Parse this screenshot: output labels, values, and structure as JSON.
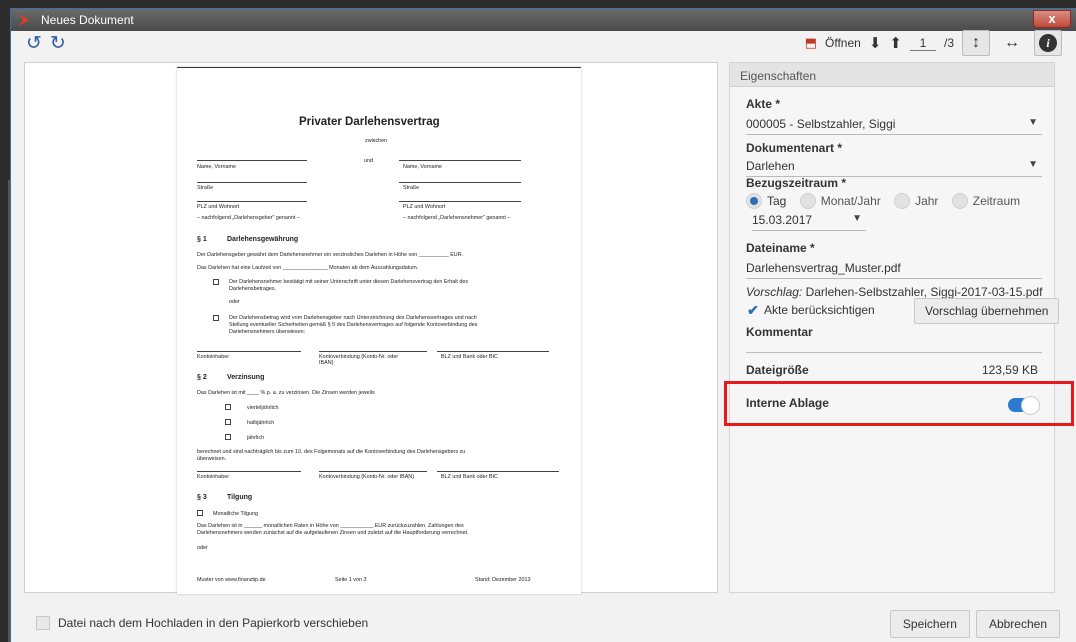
{
  "window": {
    "title": "Neues Dokument",
    "close_label": "x"
  },
  "toolbar": {
    "undo_icon": "undo-icon",
    "redo_icon": "redo-icon",
    "open_label": "Öffnen",
    "page_current": "1",
    "page_total": "/3"
  },
  "document": {
    "title": "Privater Darlehensvertrag",
    "zwischen": "zwischen",
    "und": "und",
    "name_left": "Name, Vorname",
    "name_right": "Name, Vorname",
    "strasse_left": "Straße",
    "strasse_right": "Straße",
    "plz_left": "PLZ und Wohnort",
    "plz_right": "PLZ und Wohnort",
    "nachfolgend_left": "– nachfolgend „Darlehensgeber\" genannt –",
    "nachfolgend_right": "– nachfolgend „Darlehensnehmer\" genannt –",
    "s1_num": "§ 1",
    "s1_title": "Darlehensgewährung",
    "s1_p1": "Der Darlehensgeber gewährt dem Darlehensnehmer ein verzinsliches Darlehen in Höhe von __________ EUR.",
    "s1_p2": "Das Darlehen hat eine Laufzeit von _______________ Monaten ab dem Auszahlungsdatum.",
    "s1_opt1a": "Der Darlehensnehmer bestätigt mit seiner Unterschrift unter diesen Darlehensvertrag den Erhalt des",
    "s1_opt1b": "Darlehensbetrages.",
    "s1_oder": "oder",
    "s1_opt2a": "Der Darlehensbetrag wird vom Darlehensgeber nach Unterzeichnung des Darlehensvertrages und nach",
    "s1_opt2b": "Stellung eventueller Sicherheiten gemäß § 5 des Darlehensvertrages auf folgende Kontoverbindung des",
    "s1_opt2c": "Darlehensnehmers überwiesen:",
    "kontoinhaber": "Kontoinhaber",
    "kontoverbindung_a": "Kontoverbindung (Konto-Nr. oder",
    "kontoverbindung_b": "IBAN)",
    "blz": "BLZ und Bank oder BIC",
    "s2_num": "§ 2",
    "s2_title": "Verzinsung",
    "s2_p1": "Das Darlehen ist mit ____ % p. a. zu verzinsen. Die Zinsen werden jeweils",
    "s2_o1": "vierteljährlich",
    "s2_o2": "halbjährlich",
    "s2_o3": "jährlich",
    "s2_p2a": "berechnet und sind nachträglich bis zum 10. des Folgemonats auf die Kontoverbindung des Darlehensgebers zu",
    "s2_p2b": "überweisen.",
    "kontoinhaber2": "Kontoinhaber",
    "kontoverbindung2": "Kontoverbindung (Konto-Nr. oder IBAN)",
    "blz2": "BLZ und Bank oder BIC",
    "s3_num": "§ 3",
    "s3_title": "Tilgung",
    "s3_o1": "Monatliche Tilgung",
    "s3_p1a": "Das Darlehen ist in ______ monatlichen Raten in Höhe von ___________ EUR zurückzuzahlen. Zahlungen des",
    "s3_p1b": "Darlehensnehmers werden zunächst auf die aufgelaufenen Zinsen und zuletzt auf die Hauptforderung verrechnet.",
    "s3_oder": "oder",
    "footer_left": "Muster von www.finanztip.de",
    "footer_mid": "Seite 1 von 3",
    "footer_right": "Stand: Dezember 2013"
  },
  "properties": {
    "header": "Eigenschaften",
    "akte_label": "Akte *",
    "akte_value": "000005 - Selbstzahler, Siggi",
    "dokumentenart_label": "Dokumentenart *",
    "dokumentenart_value": "Darlehen",
    "bezugszeitraum_label": "Bezugszeitraum *",
    "radio_tag": "Tag",
    "radio_monat": "Monat/Jahr",
    "radio_jahr": "Jahr",
    "radio_zeitraum": "Zeitraum",
    "date_value": "15.03.2017",
    "dateiname_label": "Dateiname *",
    "dateiname_value": "Darlehensvertrag_Muster.pdf",
    "vorschlag_label": "Vorschlag:",
    "vorschlag_value": "Darlehen-Selbstzahler, Siggi-2017-03-15.pdf",
    "akte_check_label": "Akte berücksichtigen",
    "vorschlag_button": "Vorschlag übernehmen",
    "kommentar_label": "Kommentar",
    "dateigroesse_label": "Dateigröße",
    "dateigroesse_value": "123,59 KB",
    "interne_ablage_label": "Interne Ablage",
    "interne_ablage_on": true
  },
  "footer": {
    "papierkorb_label": "Datei nach dem Hochladen in den Papierkorb verschieben",
    "save_label": "Speichern",
    "cancel_label": "Abbrechen"
  },
  "colors": {
    "accent": "#2b7bd1",
    "highlight": "#e8191c",
    "titlebar": "#4a4a4a"
  }
}
